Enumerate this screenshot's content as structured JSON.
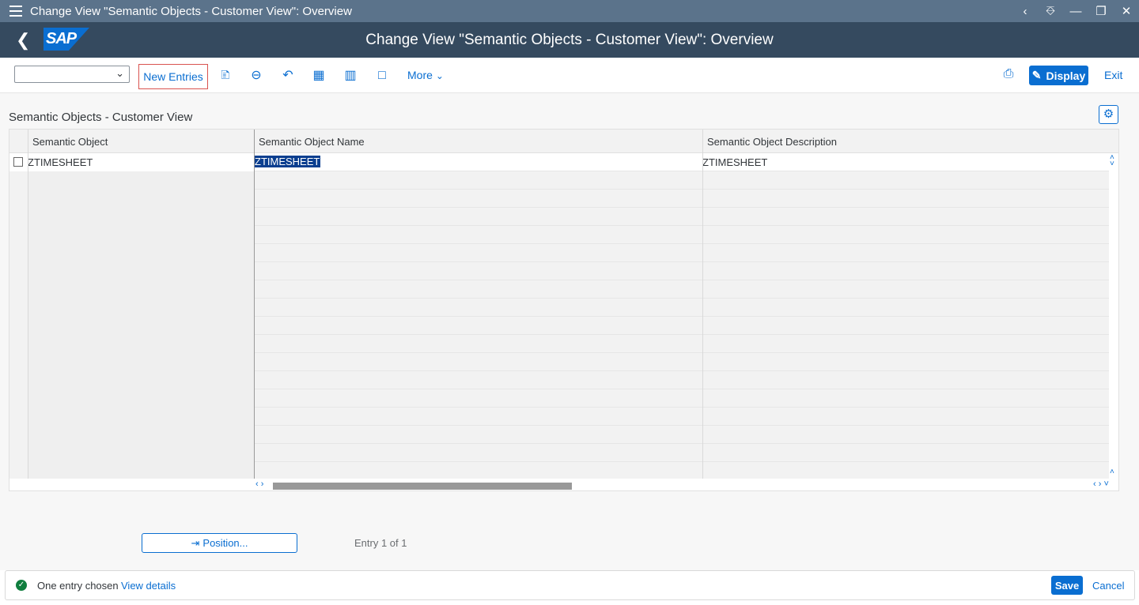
{
  "window": {
    "title": "Change View \"Semantic Objects - Customer View\": Overview"
  },
  "shell": {
    "title": "Change View \"Semantic Objects - Customer View\": Overview",
    "logo_text": "SAP"
  },
  "toolbar": {
    "select_value": "",
    "new_entries_label": "New Entries",
    "more_label": "More",
    "display_label": "Display",
    "exit_label": "Exit",
    "icons": [
      "copy-icon",
      "delete-icon",
      "undo-icon",
      "select-all-icon",
      "select-block-icon",
      "deselect-all-icon"
    ]
  },
  "section": {
    "title": "Semantic Objects - Customer View"
  },
  "table": {
    "columns": [
      "Semantic Object",
      "Semantic Object Name",
      "Semantic Object Description"
    ],
    "rows": [
      {
        "semantic_object": "ZTIMESHEET",
        "name": "ZTIMESHEET",
        "description": "ZTIMESHEET"
      }
    ]
  },
  "position_button": {
    "label": "Position..."
  },
  "entry_info": "Entry 1 of 1",
  "footer": {
    "message": "One entry chosen",
    "view_details": "View details",
    "save_label": "Save",
    "cancel_label": "Cancel"
  },
  "colors": {
    "shell": "#354a5f",
    "window_bar": "#5b738b",
    "accent": "#0a6ed1",
    "success": "#107e3e",
    "highlight": "#0a3e8f"
  }
}
